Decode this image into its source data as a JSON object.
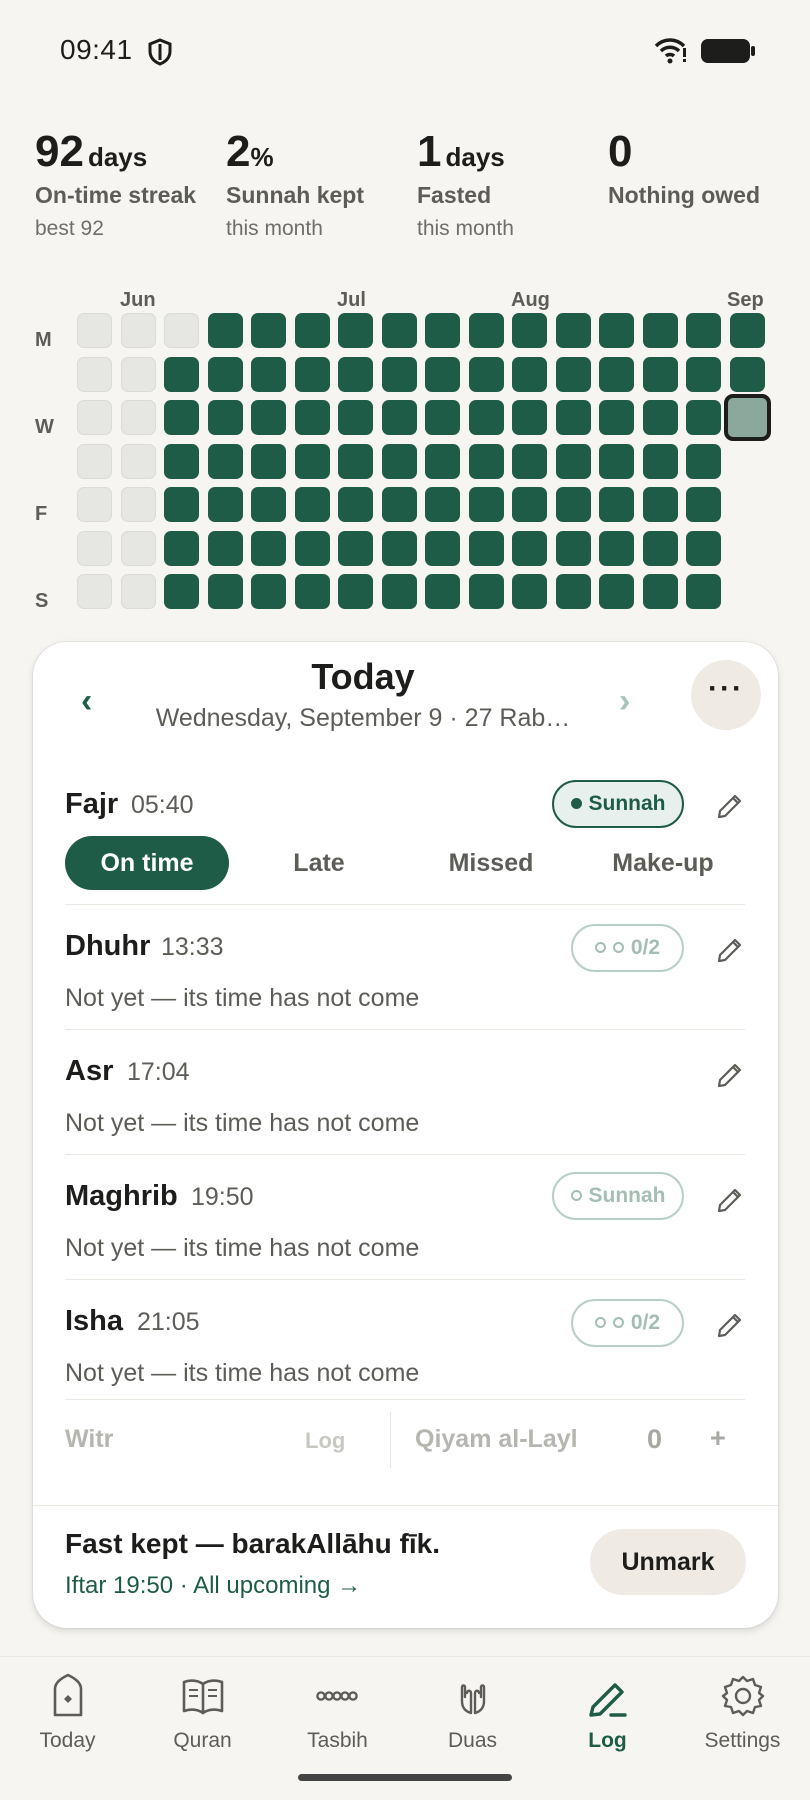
{
  "status_bar": {
    "time": "09:41"
  },
  "stats": [
    {
      "value": "92",
      "unit": "days",
      "label": "On-time streak",
      "sub": "best 92"
    },
    {
      "value": "2",
      "unit": "%",
      "label": "Sunnah kept",
      "sub": "this month"
    },
    {
      "value": "1",
      "unit": "days",
      "label": "Fasted",
      "sub": "this month"
    },
    {
      "value": "0",
      "unit": "",
      "label": "Nothing owed",
      "sub": ""
    }
  ],
  "heatmap": {
    "months": [
      "Jun",
      "Jul",
      "Aug",
      "Sep"
    ],
    "day_labels": [
      "M",
      "W",
      "F",
      "S"
    ],
    "weeks": 16,
    "columns": [
      [
        "empty",
        "empty",
        "empty",
        "empty",
        "empty",
        "empty",
        "empty"
      ],
      [
        "empty",
        "empty",
        "empty",
        "empty",
        "empty",
        "empty",
        "empty"
      ],
      [
        "empty",
        "full",
        "full",
        "full",
        "full",
        "full",
        "full"
      ],
      [
        "full",
        "full",
        "full",
        "full",
        "full",
        "full",
        "full"
      ],
      [
        "full",
        "full",
        "full",
        "full",
        "full",
        "full",
        "full"
      ],
      [
        "full",
        "full",
        "full",
        "full",
        "full",
        "full",
        "full"
      ],
      [
        "full",
        "full",
        "full",
        "full",
        "full",
        "full",
        "full"
      ],
      [
        "full",
        "full",
        "full",
        "full",
        "full",
        "full",
        "full"
      ],
      [
        "full",
        "full",
        "full",
        "full",
        "full",
        "full",
        "full"
      ],
      [
        "full",
        "full",
        "full",
        "full",
        "full",
        "full",
        "full"
      ],
      [
        "full",
        "full",
        "full",
        "full",
        "full",
        "full",
        "full"
      ],
      [
        "full",
        "full",
        "full",
        "full",
        "full",
        "full",
        "full"
      ],
      [
        "full",
        "full",
        "full",
        "full",
        "full",
        "full",
        "full"
      ],
      [
        "full",
        "full",
        "full",
        "full",
        "full",
        "full",
        "full"
      ],
      [
        "full",
        "full",
        "full",
        "full",
        "full",
        "full",
        "full"
      ],
      [
        "full",
        "full",
        "today"
      ]
    ]
  },
  "card": {
    "title": "Today",
    "subtitle": "Wednesday, September 9 · 27 Rab…",
    "prev_label": "‹",
    "next_label": "›",
    "more_label": "···"
  },
  "prayers": [
    {
      "name": "Fajr",
      "time": "05:40",
      "pill": "Sunnah",
      "note": ""
    },
    {
      "name": "Dhuhr",
      "time": "13:33",
      "pill": "0/2",
      "note": "Not yet — its time has not come"
    },
    {
      "name": "Asr",
      "time": "17:04",
      "pill": "",
      "note": "Not yet — its time has not come"
    },
    {
      "name": "Maghrib",
      "time": "19:50",
      "pill": "Sunnah",
      "note": "Not yet — its time has not come"
    },
    {
      "name": "Isha",
      "time": "21:05",
      "pill": "0/2",
      "note": "Not yet — its time has not come"
    }
  ],
  "status_options": [
    "On time",
    "Late",
    "Missed",
    "Make-up"
  ],
  "extras": {
    "witr_label": "Witr",
    "witr_action": "Log",
    "qiyam_label": "Qiyam al-Layl",
    "qiyam_count": "0",
    "qiyam_add": "+"
  },
  "fast": {
    "title": "Fast kept — barakAllāhu fīk.",
    "link": "Iftar 19:50 · All upcoming →",
    "unmark_label": "Unmark"
  },
  "bottom_nav": [
    {
      "label": "Today",
      "icon": "mosque-icon"
    },
    {
      "label": "Quran",
      "icon": "book-icon"
    },
    {
      "label": "Tasbih",
      "icon": "beads-icon"
    },
    {
      "label": "Duas",
      "icon": "hands-icon"
    },
    {
      "label": "Log",
      "icon": "pencil-icon"
    },
    {
      "label": "Settings",
      "icon": "gear-icon"
    }
  ],
  "colors": {
    "accent": "#1f5c47",
    "background": "#f7f5f1",
    "empty_cell": "#e6e7e2"
  }
}
